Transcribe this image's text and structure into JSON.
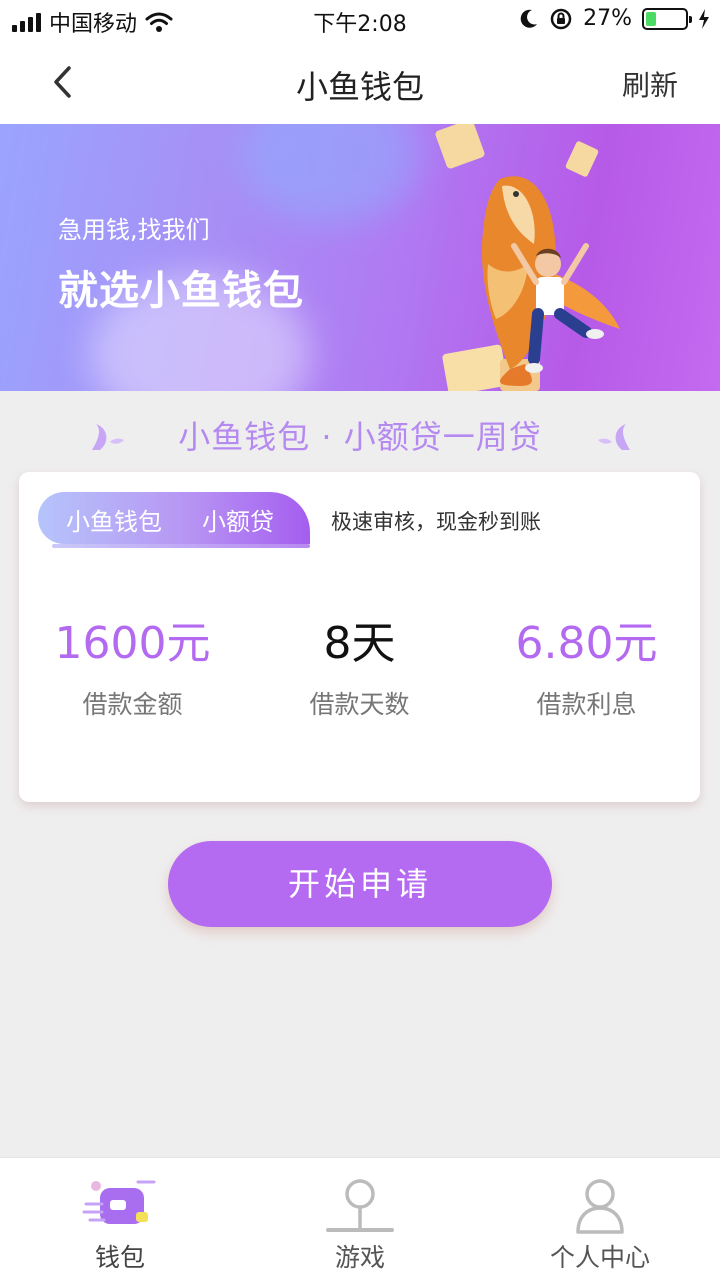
{
  "status_bar": {
    "carrier": "中国移动",
    "time": "下午2:08",
    "battery": "27%",
    "battery_level": 0.27
  },
  "nav": {
    "title": "小鱼钱包",
    "refresh_label": "刷新",
    "back_icon": "chevron-left-icon"
  },
  "banner": {
    "subtitle": "急用钱,找我们",
    "title": "就选小鱼钱包"
  },
  "section_heading": "小鱼钱包 · 小额贷一周贷",
  "card": {
    "tag_left": "小鱼钱包",
    "tag_right": "小额贷",
    "slogan": "极速审核，现金秒到账",
    "stats": [
      {
        "value": "1600元",
        "label": "借款金额"
      },
      {
        "value": "8天",
        "label": "借款天数"
      },
      {
        "value": "6.80元",
        "label": "借款利息"
      }
    ]
  },
  "apply_button_label": "开始申请",
  "tab_bar": {
    "items": [
      {
        "label": "钱包",
        "icon": "wallet-icon",
        "active": true
      },
      {
        "label": "游戏",
        "icon": "game-icon",
        "active": false
      },
      {
        "label": "个人中心",
        "icon": "user-icon",
        "active": false
      }
    ]
  },
  "colors": {
    "accent": "#b46bf1",
    "stat_purple": "#b36af0",
    "background": "#efeeef"
  }
}
